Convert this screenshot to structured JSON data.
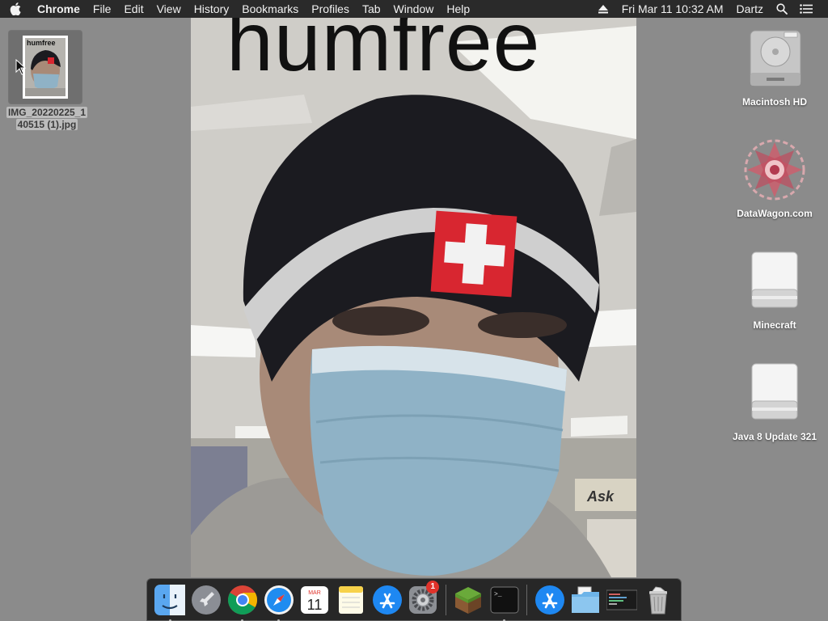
{
  "menubar": {
    "app_name": "Chrome",
    "items": [
      "File",
      "Edit",
      "View",
      "History",
      "Bookmarks",
      "Profiles",
      "Tab",
      "Window",
      "Help"
    ],
    "datetime": "Fri Mar 11  10:32 AM",
    "user": "Dartz"
  },
  "photo": {
    "caption": "humfree"
  },
  "desktop": {
    "selected_file": {
      "thumb_text": "humfree",
      "label_line1": "IMG_20220225_1",
      "label_line2": "40515 (1).jpg"
    },
    "icons": [
      {
        "label": "Macintosh HD",
        "icon": "hard-drive-icon"
      },
      {
        "label": "DataWagon.com",
        "icon": "datawagon-logo-icon"
      },
      {
        "label": "Minecraft",
        "icon": "disk-image-icon"
      },
      {
        "label": "Java 8 Update 321",
        "icon": "disk-image-icon"
      }
    ]
  },
  "dock": {
    "apps": [
      {
        "name": "finder",
        "running": true
      },
      {
        "name": "launchpad",
        "running": false
      },
      {
        "name": "chrome",
        "running": true
      },
      {
        "name": "safari",
        "running": true
      },
      {
        "name": "calendar",
        "running": false,
        "month": "MAR",
        "day": "11"
      },
      {
        "name": "notes",
        "running": false
      },
      {
        "name": "app-store",
        "running": false
      },
      {
        "name": "system-preferences",
        "running": false,
        "badge": "1"
      },
      {
        "name": "minecraft",
        "running": false
      },
      {
        "name": "terminal",
        "running": true
      },
      {
        "name": "app-store-folder",
        "running": false
      },
      {
        "name": "documents-folder",
        "running": false
      },
      {
        "name": "console-thumbnail",
        "running": false
      },
      {
        "name": "trash",
        "running": false
      }
    ]
  }
}
